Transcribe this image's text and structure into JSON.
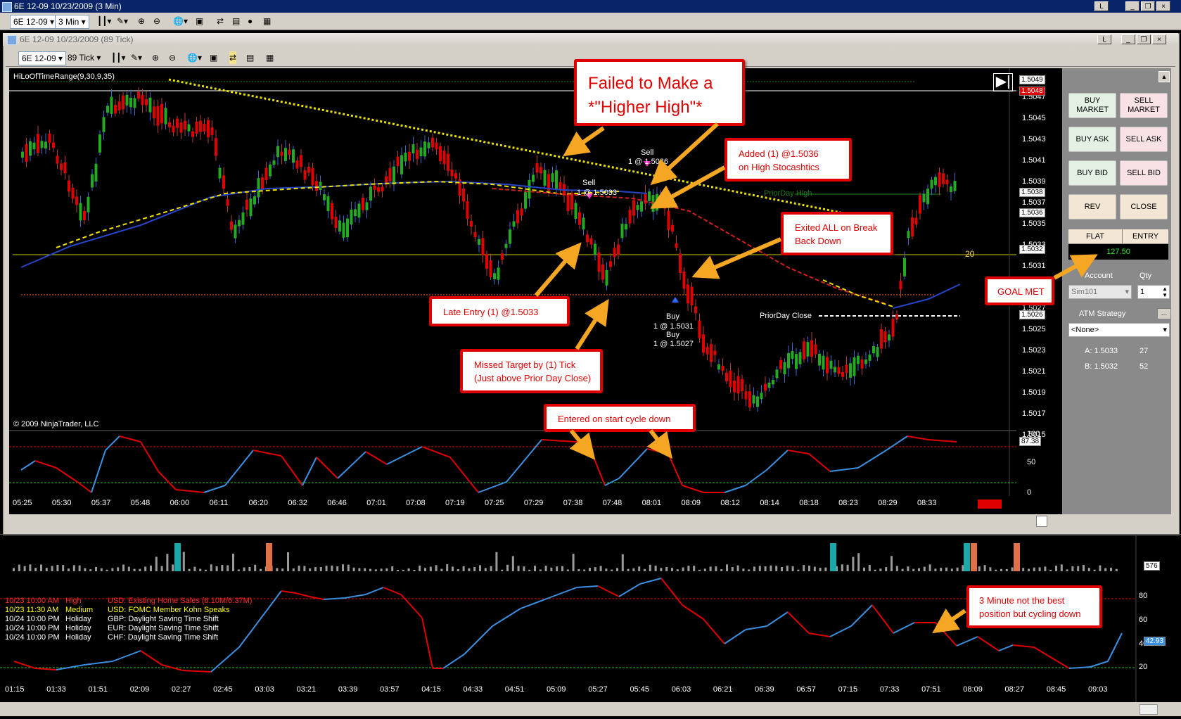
{
  "outer": {
    "title": "6E 12-09  10/23/2009 (3 Min)",
    "instrument": "6E 12-09",
    "interval": "3 Min"
  },
  "inner": {
    "title": "6E 12-09  10/23/2009 (89 Tick)",
    "instrument": "6E 12-09",
    "interval": "89 Tick",
    "indicator": "HiLoOfTimeRange(9,30,9,35)",
    "copyright": "© 2009 NinjaTrader, LLC",
    "link_label": "L"
  },
  "price_axis": [
    "1.5047",
    "1.5045",
    "1.5043",
    "1.5041",
    "1.5039",
    "1.5037",
    "1.5035",
    "1.5033",
    "1.5031",
    "1.5029",
    "1.5027",
    "1.5025",
    "1.5023",
    "1.5021",
    "1.5019",
    "1.5017",
    "1.5015"
  ],
  "price_boxes": {
    "high": "1.5049",
    "current": "1.5048",
    "a": "1.5038",
    "b": "1.5036",
    "c": "1.5032",
    "d": "1.5026"
  },
  "stoch_axis": [
    "100",
    "50",
    "0"
  ],
  "stoch_value": "87.38",
  "time_axis": [
    "05:25",
    "05:30",
    "05:37",
    "05:48",
    "06:00",
    "06:11",
    "06:20",
    "06:32",
    "06:46",
    "07:01",
    "07:08",
    "07:19",
    "07:25",
    "07:29",
    "07:38",
    "07:48",
    "08:01",
    "08:09",
    "08:12",
    "08:14",
    "08:18",
    "08:23",
    "08:29",
    "08:33"
  ],
  "labels": {
    "prior_high": "PriorDay High",
    "prior_close": "PriorDay Close",
    "range_value": "20",
    "sell1a": "Sell",
    "sell1b": "1 @ 1.5036",
    "sell2a": "Sell",
    "sell2b": "1 @ 1.5033",
    "buy1a": "Buy",
    "buy1b": "1 @ 1.5031",
    "buy2a": "Buy",
    "buy2b": "1 @ 1.5027"
  },
  "callouts": {
    "higher_high_1": "Failed to Make a",
    "higher_high_2": "*\"Higher High\"*",
    "added_1": "Added (1) @1.5036",
    "added_2": "on High Stocashtics",
    "exited_1": "Exited ALL on Break",
    "exited_2": "Back Down",
    "late_entry": "Late Entry (1) @1.5033",
    "missed_1": "Missed Target by (1) Tick",
    "missed_2": "(Just above Prior Day Close)",
    "entered": "Entered on start cycle down",
    "goal": "GOAL MET",
    "three_min_1": "3 Minute not the best",
    "three_min_2": "position but cycling down"
  },
  "order_panel": {
    "buy_market": "BUY MARKET",
    "sell_market": "SELL MARKET",
    "buy_ask": "BUY ASK",
    "sell_ask": "SELL ASK",
    "buy_bid": "BUY BID",
    "sell_bid": "SELL BID",
    "rev": "REV",
    "close": "CLOSE",
    "flat": "FLAT",
    "entry": "ENTRY",
    "pnl": "127.50",
    "account_label": "Account",
    "qty_label": "Qty",
    "account": "Sim101",
    "qty": "1",
    "atm_label": "ATM Strategy",
    "atm_value": "<None>",
    "bid_row": "A: 1.5033",
    "bid_size": "27",
    "ask_row": "B: 1.5032",
    "ask_size": "52"
  },
  "bottom": {
    "volume_value": "576",
    "stoch_axis": [
      "80",
      "60",
      "40",
      "20"
    ],
    "stoch_value": "42.93",
    "time_axis": [
      "01:15",
      "01:33",
      "01:51",
      "02:09",
      "02:27",
      "02:45",
      "03:03",
      "03:21",
      "03:39",
      "03:57",
      "04:15",
      "04:33",
      "04:51",
      "05:09",
      "05:27",
      "05:45",
      "06:03",
      "06:21",
      "06:39",
      "06:57",
      "07:15",
      "07:33",
      "07:51",
      "08:09",
      "08:27",
      "08:45",
      "09:03"
    ],
    "news": [
      {
        "time": "10/23 10:00 AM",
        "impact": "High",
        "text": "USD: Existing Home Sales (6.10M/6.37M)",
        "color": "#ff2a2a"
      },
      {
        "time": "10/23 11:30 AM",
        "impact": "Medium",
        "text": "USD: FOMC Member Kohn Speaks",
        "color": "#ffff00"
      },
      {
        "time": "10/24 10:00 PM",
        "impact": "Holiday",
        "text": "GBP: Daylight Saving Time Shift",
        "color": "#ffffff"
      },
      {
        "time": "10/24 10:00 PM",
        "impact": "Holiday",
        "text": "EUR: Daylight Saving Time Shift",
        "color": "#ffffff"
      },
      {
        "time": "10/24 10:00 PM",
        "impact": "Holiday",
        "text": "CHF: Daylight Saving Time Shift",
        "color": "#ffffff"
      }
    ]
  },
  "colors": {
    "up": "#22aa22",
    "down": "#e00000",
    "callout": "#e10000",
    "arrow": "#f5a623",
    "stoch_up": "#3b8fe0",
    "stoch_down": "#e00000"
  }
}
